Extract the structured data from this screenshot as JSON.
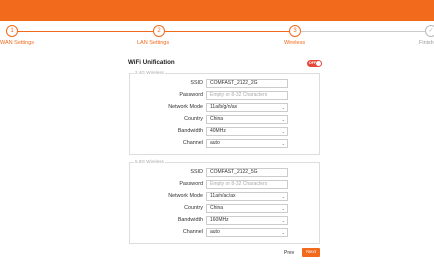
{
  "steps": [
    {
      "number": "1",
      "label": "WAN Settings"
    },
    {
      "number": "2",
      "label": "LAN Settings"
    },
    {
      "number": "3",
      "label": "Wireless"
    },
    {
      "number": "✓",
      "label": "Finish"
    }
  ],
  "wifi": {
    "title": "WiFi Unification",
    "toggle_text": "OFF"
  },
  "group_24": {
    "legend": "2.4G Wireless",
    "ssid_label": "SSID",
    "ssid_value": "COMFAST_2122_2G",
    "password_label": "Password",
    "password_placeholder": "Empty or 8-32 Characters",
    "mode_label": "Network Mode",
    "mode_value": "11a/b/g/n/ax",
    "country_label": "Country",
    "country_value": "China",
    "bandwidth_label": "Bandwidth",
    "bandwidth_value": "40MHz",
    "channel_label": "Channel",
    "channel_value": "auto"
  },
  "group_5": {
    "legend": "5.8G Wireless",
    "ssid_label": "SSID",
    "ssid_value": "COMFAST_2122_5G",
    "password_label": "Password",
    "password_placeholder": "Empty or 8-32 Characters",
    "mode_label": "Network Mode",
    "mode_value": "11a/n/ac/ax",
    "country_label": "Country",
    "country_value": "China",
    "bandwidth_label": "Bandwidth",
    "bandwidth_value": "160MHz",
    "channel_label": "Channel",
    "channel_value": "auto"
  },
  "nav": {
    "prev": "Prev",
    "next": "Next"
  },
  "colors": {
    "accent": "#f26a1b",
    "toggle_off": "#e34a3c"
  }
}
